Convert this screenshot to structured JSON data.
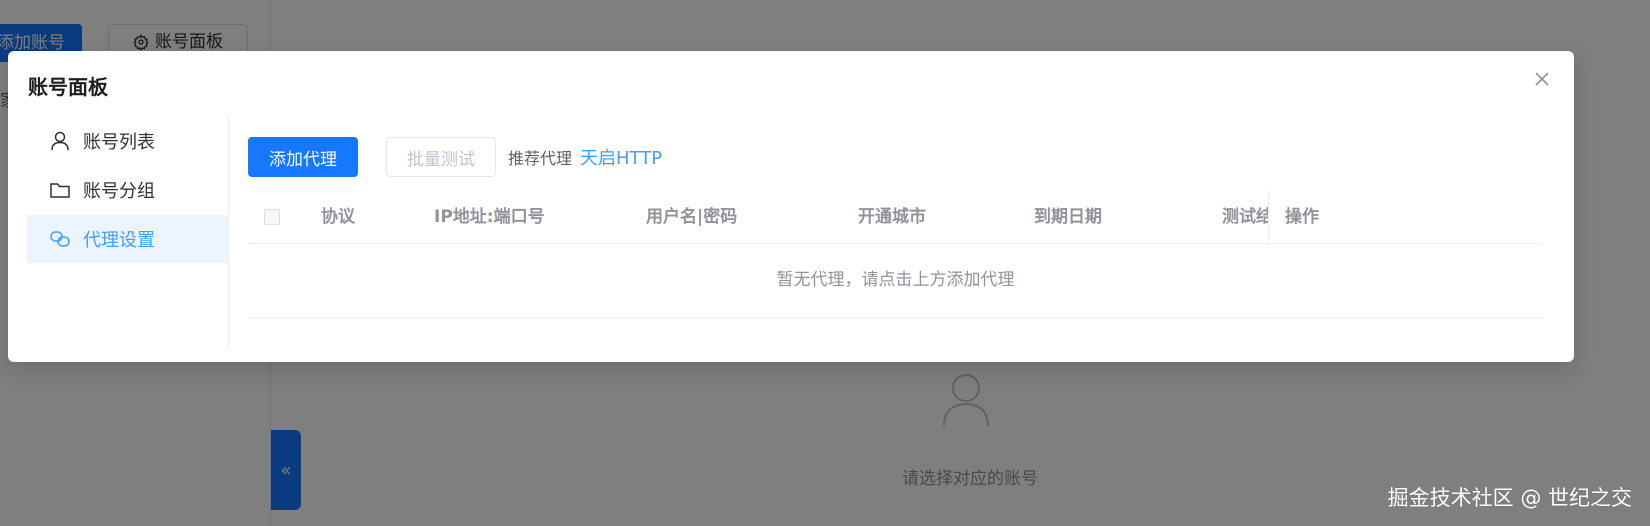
{
  "background": {
    "add_account_label": "添加账号",
    "account_panel_label": "账号面板",
    "sidebar_cut_char": "家",
    "collapse_icon": "«",
    "empty_text": "请选择对应的账号",
    "watermark": "掘金技术社区 @ 世纪之交"
  },
  "dialog": {
    "title": "账号面板",
    "menu": [
      {
        "label": "账号列表",
        "icon": "user-icon",
        "active": false
      },
      {
        "label": "账号分组",
        "icon": "folder-icon",
        "active": false
      },
      {
        "label": "代理设置",
        "icon": "link-icon",
        "active": true
      }
    ],
    "toolbar": {
      "add_proxy_label": "添加代理",
      "batch_test_label": "批量测试",
      "recommend_label": "推荐代理",
      "recommend_link": "天启HTTP"
    },
    "table": {
      "columns": [
        "协议",
        "IP地址:端口号",
        "用户名|密码",
        "开通城市",
        "到期日期",
        "测试结果",
        "操作"
      ],
      "empty_text": "暂无代理，请点击上方添加代理"
    }
  },
  "colors": {
    "primary": "#1677ff",
    "link": "#409eff",
    "active_bg": "#ecf5ff"
  }
}
